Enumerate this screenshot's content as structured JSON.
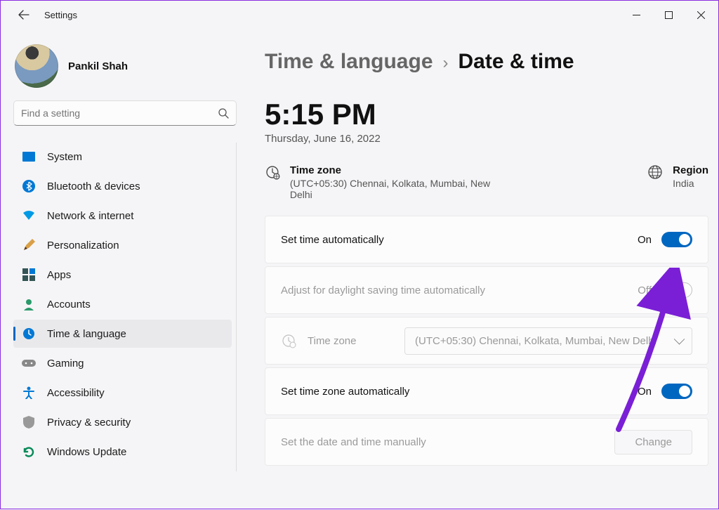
{
  "window": {
    "title": "Settings"
  },
  "profile": {
    "name": "Pankil Shah"
  },
  "search": {
    "placeholder": "Find a setting"
  },
  "sidebar": {
    "items": [
      {
        "label": "System",
        "icon": "system-icon"
      },
      {
        "label": "Bluetooth & devices",
        "icon": "bluetooth-icon"
      },
      {
        "label": "Network & internet",
        "icon": "wifi-icon"
      },
      {
        "label": "Personalization",
        "icon": "personalization-icon"
      },
      {
        "label": "Apps",
        "icon": "apps-icon"
      },
      {
        "label": "Accounts",
        "icon": "accounts-icon"
      },
      {
        "label": "Time & language",
        "icon": "time-language-icon"
      },
      {
        "label": "Gaming",
        "icon": "gaming-icon"
      },
      {
        "label": "Accessibility",
        "icon": "accessibility-icon"
      },
      {
        "label": "Privacy & security",
        "icon": "privacy-icon"
      },
      {
        "label": "Windows Update",
        "icon": "update-icon"
      }
    ],
    "active_index": 6
  },
  "breadcrumb": {
    "parent": "Time & language",
    "current": "Date & time"
  },
  "clock": {
    "time": "5:15 PM",
    "date": "Thursday, June 16, 2022"
  },
  "info": {
    "timezone_label": "Time zone",
    "timezone_value": "(UTC+05:30) Chennai, Kolkata, Mumbai, New Delhi",
    "region_label": "Region",
    "region_value": "India"
  },
  "settings": {
    "set_time_auto": {
      "label": "Set time automatically",
      "state": "On",
      "on": true,
      "enabled": true
    },
    "dst_auto": {
      "label": "Adjust for daylight saving time automatically",
      "state": "Off",
      "on": false,
      "enabled": false
    },
    "timezone_select": {
      "label": "Time zone",
      "value": "(UTC+05:30) Chennai, Kolkata, Mumbai, New Delhi",
      "enabled": false
    },
    "set_tz_auto": {
      "label": "Set time zone automatically",
      "state": "On",
      "on": true,
      "enabled": true
    },
    "set_manual": {
      "label": "Set the date and time manually",
      "button": "Change",
      "enabled": false
    }
  },
  "colors": {
    "accent": "#0067c0",
    "annotation": "#7a1fd6"
  }
}
